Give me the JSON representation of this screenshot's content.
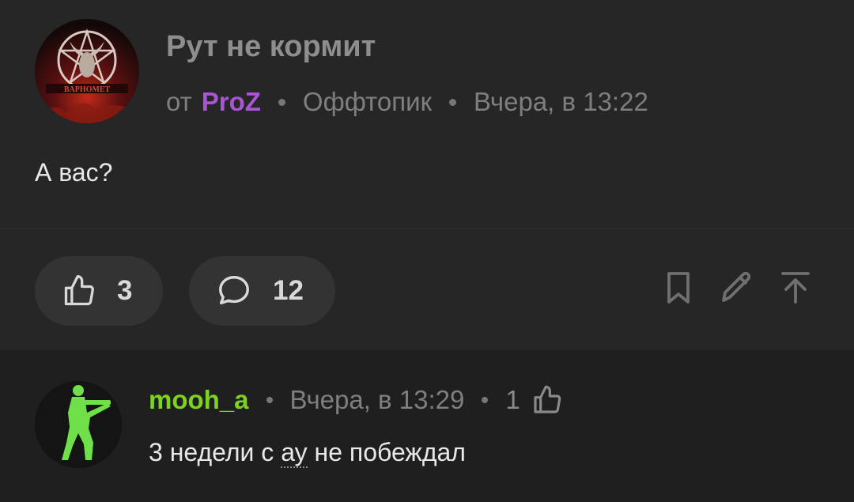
{
  "post": {
    "title": "Рут не кормит",
    "by_prefix": "от",
    "author": "ProZ",
    "category": "Оффтопик",
    "time": "Вчера, в 13:22",
    "body": "А вас?",
    "avatar_icon": "baphomet-pentagram-avatar",
    "actions": {
      "likes": "3",
      "comments": "12",
      "like_icon": "thumbs-up-icon",
      "comment_icon": "comment-bubble-icon",
      "bookmark_icon": "bookmark-icon",
      "edit_icon": "pencil-icon",
      "scroll_top_icon": "arrow-up-to-top-icon"
    }
  },
  "comment": {
    "author": "mooh_a",
    "time": "Вчера, в 13:29",
    "likes": "1",
    "text_before": "3 недели с ",
    "text_underlined": "ау",
    "text_after": " не побеждал",
    "avatar_icon": "soldier-silhouette-avatar"
  },
  "colors": {
    "background": "#262626",
    "comment_background": "#1f1f1f",
    "pill": "#333333",
    "post_author": "#a855d6",
    "comment_author": "#7ed321",
    "muted": "#7f7f7f"
  }
}
